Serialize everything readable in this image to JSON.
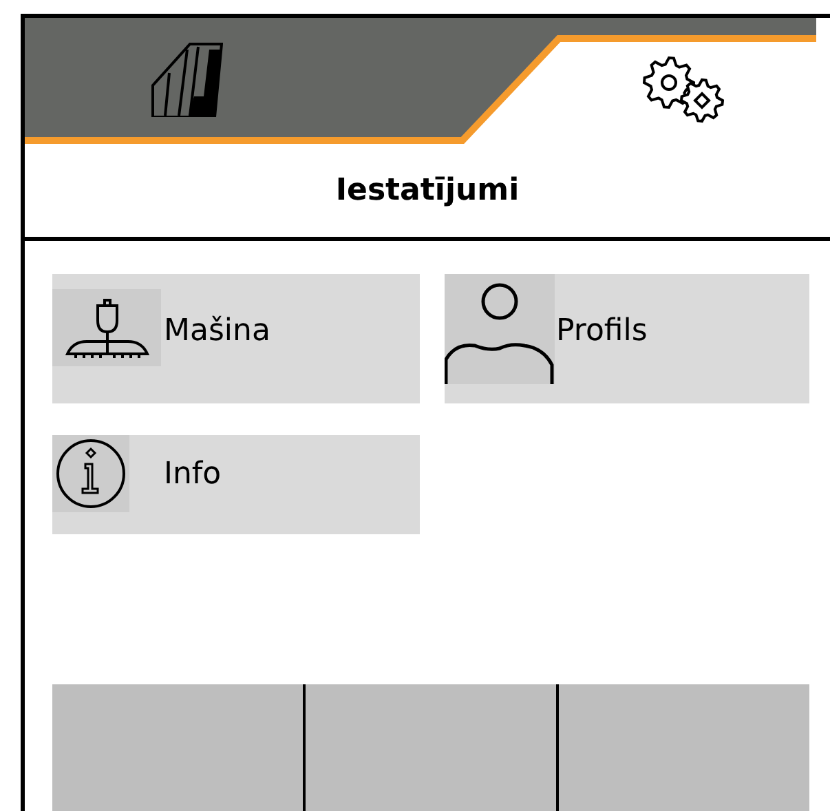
{
  "tabs": [
    {
      "kind": "field",
      "selected": false
    },
    {
      "kind": "settings",
      "selected": true
    }
  ],
  "title": "Iestatījumi",
  "menu": [
    {
      "kind": "machine",
      "label": "Mašina"
    },
    {
      "kind": "profile",
      "label": "Profils"
    },
    {
      "kind": "info",
      "label": "Info"
    }
  ],
  "softkeys": [
    {
      "kind": "empty"
    },
    {
      "kind": "empty"
    },
    {
      "kind": "empty"
    }
  ]
}
